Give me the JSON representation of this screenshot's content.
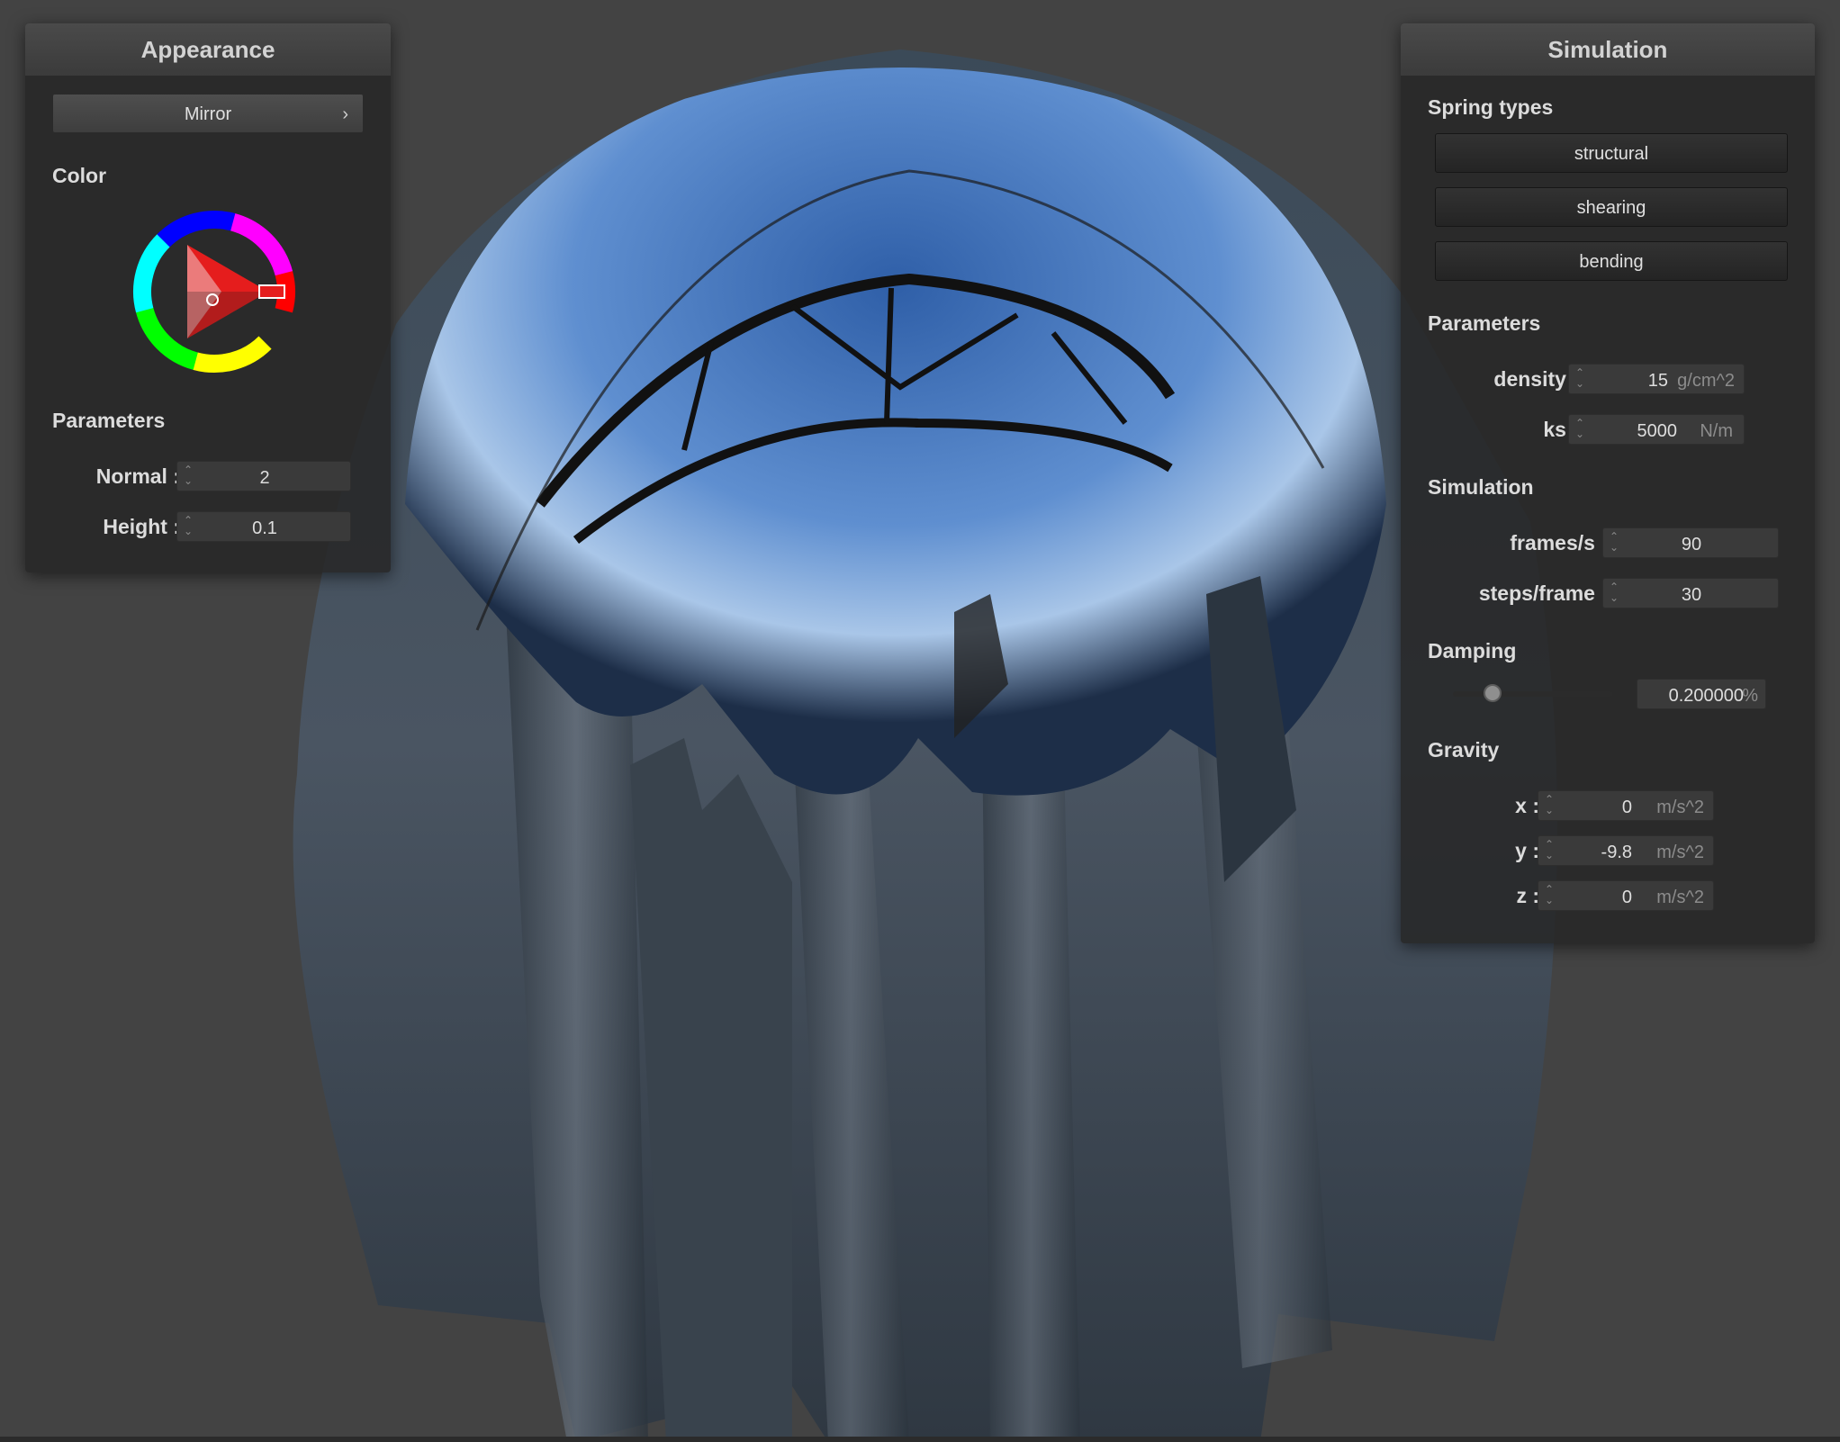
{
  "appearance": {
    "title": "Appearance",
    "material_button": "Mirror",
    "material_chevron": "›",
    "color_label": "Color",
    "selected_color": "#e51d1d",
    "params_label": "Parameters",
    "normal_label": "Normal :",
    "normal_value": "2",
    "height_label": "Height :",
    "height_value": "0.1"
  },
  "simulation": {
    "title": "Simulation",
    "spring_types_label": "Spring types",
    "spring_buttons": [
      "structural",
      "shearing",
      "bending"
    ],
    "params_label": "Parameters",
    "density_label": "density :",
    "density_value": "15",
    "density_unit": "g/cm^2",
    "ks_label": "ks :",
    "ks_value": "5000",
    "ks_unit": "N/m",
    "sim_label": "Simulation",
    "fps_label": "frames/s :",
    "fps_value": "90",
    "steps_label": "steps/frame :",
    "steps_value": "30",
    "damping_label": "Damping",
    "damping_value": "0.200000",
    "damping_unit": "%",
    "damping_level": 0.2,
    "gravity_label": "Gravity",
    "gx_label": "x :",
    "gx_value": "0",
    "gy_label": "y :",
    "gy_value": "-9.8",
    "gz_label": "z :",
    "gz_value": "0",
    "g_unit": "m/s^2"
  }
}
